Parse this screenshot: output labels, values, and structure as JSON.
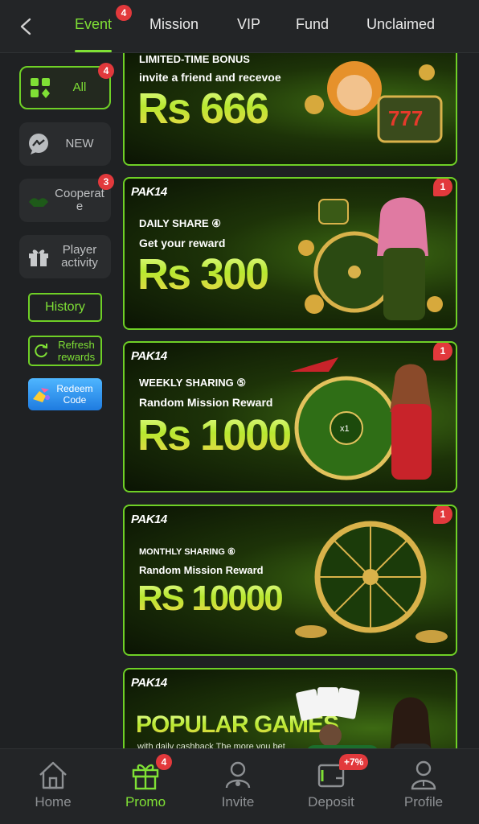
{
  "tabs": [
    {
      "label": "Event",
      "badge": "4"
    },
    {
      "label": "Mission"
    },
    {
      "label": "VIP"
    },
    {
      "label": "Fund"
    },
    {
      "label": "Unclaimed"
    }
  ],
  "sidebar": {
    "items": [
      {
        "label": "All",
        "badge": "4",
        "icon": "grid-icon"
      },
      {
        "label": "NEW",
        "icon": "chat-icon"
      },
      {
        "label": "Cooperat e",
        "badge": "3",
        "icon": "handshake-icon"
      },
      {
        "label": "Player activity",
        "icon": "gift-icon"
      }
    ],
    "history_label": "History",
    "refresh_label": "Refresh rewards",
    "redeem_label": "Redeem Code"
  },
  "banners": [
    {
      "line1": "LIMITED-TIME BONUS",
      "line2": "invite a friend and recevoe",
      "amount": "Rs 666"
    },
    {
      "logo": "PAK14",
      "line1": "DAILY SHARE ④",
      "line2": "Get your reward",
      "amount": "Rs 300",
      "badge": "1"
    },
    {
      "logo": "PAK14",
      "line1": "WEEKLY SHARING ⑤",
      "line2": "Random Mission Reward",
      "amount": "Rs 1000",
      "badge": "1"
    },
    {
      "logo": "PAK14",
      "line1": "MONTHLY SHARING ⑥",
      "line2": "Random Mission Reward",
      "amount": "RS 10000",
      "badge": "1"
    },
    {
      "logo": "PAK14",
      "line1": "POPULAR GAMES",
      "line2": "with daily cashback The more you bet"
    }
  ],
  "bottom_nav": [
    {
      "label": "Home",
      "icon": "home-icon"
    },
    {
      "label": "Promo",
      "icon": "gift-icon",
      "badge": "4"
    },
    {
      "label": "Invite",
      "icon": "users-icon"
    },
    {
      "label": "Deposit",
      "icon": "wallet-icon",
      "badge": "+7%"
    },
    {
      "label": "Profile",
      "icon": "user-icon"
    }
  ],
  "colors": {
    "accent": "#7fe035",
    "badge": "#e2393c",
    "background": "#1f2123"
  }
}
